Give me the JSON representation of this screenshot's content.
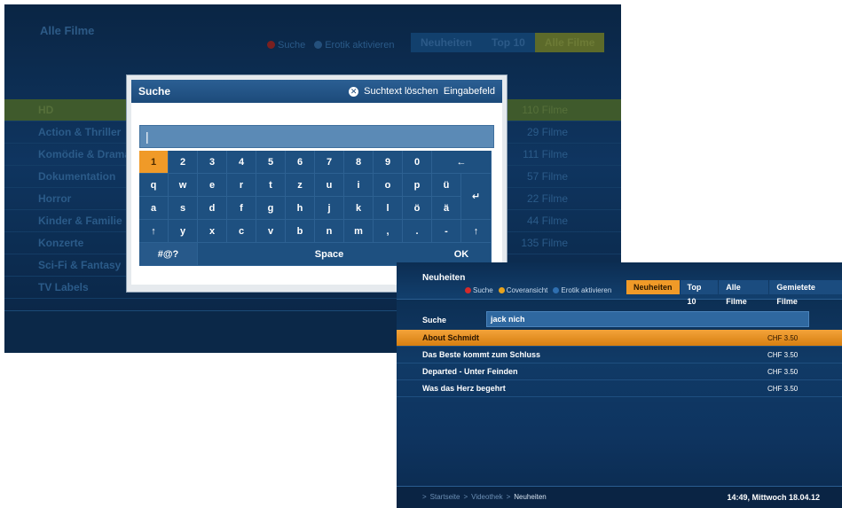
{
  "screen1": {
    "title": "Alle Filme",
    "legend": [
      {
        "label": "Suche",
        "color": "#7a2020"
      },
      {
        "label": "Erotik aktivieren",
        "color": "#24507c"
      }
    ],
    "tabs": [
      {
        "label": "Neuheiten",
        "active": false
      },
      {
        "label": "Top 10",
        "active": false
      },
      {
        "label": "Alle Filme",
        "active": true
      }
    ],
    "rows": [
      {
        "label": "HD",
        "count": "110 Filme",
        "highlight": true
      },
      {
        "label": "Action & Thriller",
        "count": "29 Filme"
      },
      {
        "label": "Komödie & Drama",
        "count": "111 Filme"
      },
      {
        "label": "Dokumentation",
        "count": "57 Filme"
      },
      {
        "label": "Horror",
        "count": "22 Filme"
      },
      {
        "label": "Kinder & Familie",
        "count": "44 Filme"
      },
      {
        "label": "Konzerte",
        "count": "135 Filme"
      },
      {
        "label": "Sci-Fi & Fantasy",
        "count": ""
      },
      {
        "label": "TV Labels",
        "count": ""
      }
    ],
    "dialog": {
      "title": "Suche",
      "clear_label": "Suchtext löschen",
      "input_label": "Eingabefeld",
      "input_value": "|",
      "keys": {
        "digits": [
          "1",
          "2",
          "3",
          "4",
          "5",
          "6",
          "7",
          "8",
          "9",
          "0"
        ],
        "row1": [
          "q",
          "w",
          "e",
          "r",
          "t",
          "z",
          "u",
          "i",
          "o",
          "p",
          "ü"
        ],
        "row2": [
          "a",
          "s",
          "d",
          "f",
          "g",
          "h",
          "j",
          "k",
          "l",
          "ö",
          "ä"
        ],
        "row3": [
          "↑",
          "y",
          "x",
          "c",
          "v",
          "b",
          "n",
          "m",
          ",",
          ".",
          "-",
          "↑"
        ],
        "backspace": "←",
        "enter": "↵",
        "symbols": "#@?",
        "space": "Space",
        "ok": "OK"
      }
    }
  },
  "screen2": {
    "title": "Neuheiten",
    "legend": [
      {
        "label": "Suche",
        "color": "#d42a2a"
      },
      {
        "label": "Coveransicht",
        "color": "#e8a31e"
      },
      {
        "label": "Erotik aktivieren",
        "color": "#2f6fb0"
      }
    ],
    "tabs": [
      {
        "label": "Neuheiten",
        "active": true
      },
      {
        "label": "Top 10",
        "active": false
      },
      {
        "label": "Alle Filme",
        "active": false
      },
      {
        "label": "Gemietete Filme",
        "active": false
      }
    ],
    "search_label": "Suche",
    "search_value": "jack nich",
    "results": [
      {
        "title": "About Schmidt",
        "price": "CHF 3.50",
        "highlight": true
      },
      {
        "title": "Das Beste kommt zum Schluss",
        "price": "CHF 3.50"
      },
      {
        "title": "Departed - Unter Feinden",
        "price": "CHF 3.50"
      },
      {
        "title": "Was das Herz begehrt",
        "price": "CHF 3.50"
      }
    ],
    "breadcrumb": [
      "Startseite",
      "Videothek",
      "Neuheiten"
    ],
    "breadcrumb_sep": ">",
    "clock": "14:49, Mittwoch 18.04.12"
  }
}
